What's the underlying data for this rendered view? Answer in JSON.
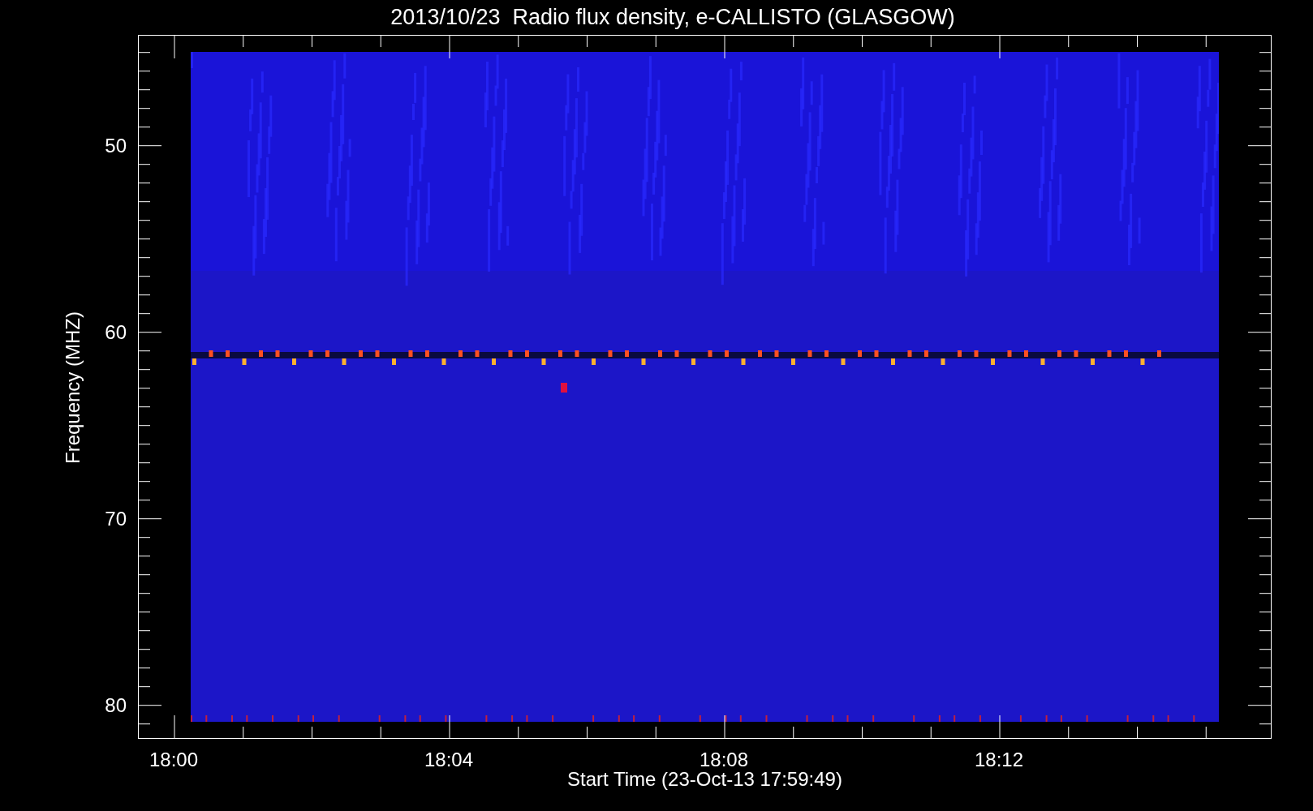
{
  "title": "2013/10/23  Radio flux density, e-CALLISTO (GLASGOW)",
  "y_axis": {
    "label": "Frequency (MHZ)",
    "ticks": [
      "50",
      "60",
      "70",
      "80"
    ]
  },
  "x_axis": {
    "label": "Start Time (23-Oct-13 17:59:49)",
    "ticks": [
      "18:00",
      "18:04",
      "18:08",
      "18:12"
    ]
  }
}
